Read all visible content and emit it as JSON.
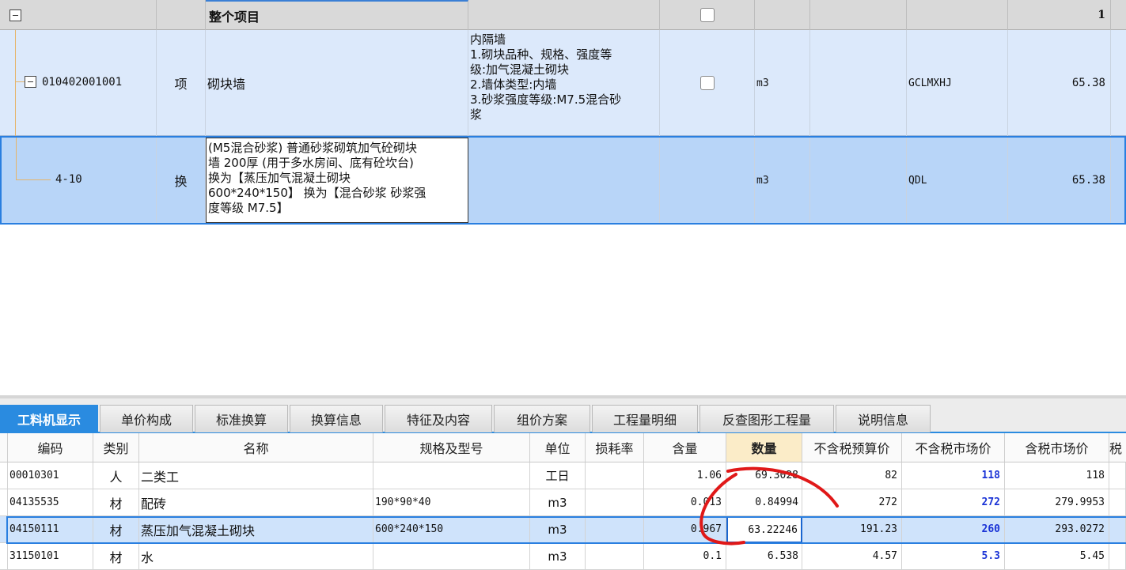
{
  "top_grid": {
    "summary_row": {
      "title": "整个项目",
      "value": "1"
    },
    "item_row": {
      "code": "010402001001",
      "type": "项",
      "name": "砌块墙",
      "features": [
        "内隔墙",
        "1.砌块品种、规格、强度等",
        "级:加气混凝土砌块",
        "2.墙体类型:内墙",
        "3.砂浆强度等级:M7.5混合砂",
        "浆"
      ],
      "unit": "m3",
      "expr": "GCLMXHJ",
      "quantity": "65.38"
    },
    "sub_row": {
      "code": "4-10",
      "type": "换",
      "name_lines": [
        "(M5混合砂浆) 普通砂浆砌筑加气砼砌块",
        "墙 200厚 (用于多水房间、底有砼坎台)",
        " 换为【蒸压加气混凝土砌块",
        "600*240*150】 换为【混合砂浆 砂浆强",
        "度等级 M7.5】"
      ],
      "unit": "m3",
      "expr": "QDL",
      "quantity": "65.38"
    }
  },
  "tabs": [
    "工料机显示",
    "单价构成",
    "标准换算",
    "换算信息",
    "特征及内容",
    "组价方案",
    "工程量明细",
    "反查图形工程量",
    "说明信息"
  ],
  "columns": [
    "编码",
    "类别",
    "名称",
    "规格及型号",
    "单位",
    "损耗率",
    "含量",
    "数量",
    "不含税预算价",
    "不含税市场价",
    "含税市场价",
    "税"
  ],
  "rows": [
    {
      "code": "00010301",
      "cat": "人",
      "name": "二类工",
      "spec": "",
      "unit": "工日",
      "loss": "",
      "content": "1.06",
      "qty": "69.3028",
      "budget": "82",
      "market": "118",
      "tax_market": "118"
    },
    {
      "code": "04135535",
      "cat": "材",
      "name": "配砖",
      "spec": "190*90*40",
      "unit": "m3",
      "loss": "",
      "content": "0.013",
      "qty": "0.84994",
      "budget": "272",
      "market": "272",
      "tax_market": "279.9953"
    },
    {
      "code": "04150111",
      "cat": "材",
      "name": "蒸压加气混凝土砌块",
      "spec": "600*240*150",
      "unit": "m3",
      "loss": "",
      "content": "0.967",
      "qty": "63.22246",
      "budget": "191.23",
      "market": "260",
      "tax_market": "293.0272"
    },
    {
      "code": "31150101",
      "cat": "材",
      "name": "水",
      "spec": "",
      "unit": "m3",
      "loss": "",
      "content": "0.1",
      "qty": "6.538",
      "budget": "4.57",
      "market": "5.3",
      "tax_market": "5.45"
    }
  ],
  "colors": {
    "accent": "#2a8be0",
    "selected_row": "#cfe3fb",
    "item_row": "#dce9fb",
    "summary_row": "#d9d9d9",
    "annotation": "#e01818"
  }
}
